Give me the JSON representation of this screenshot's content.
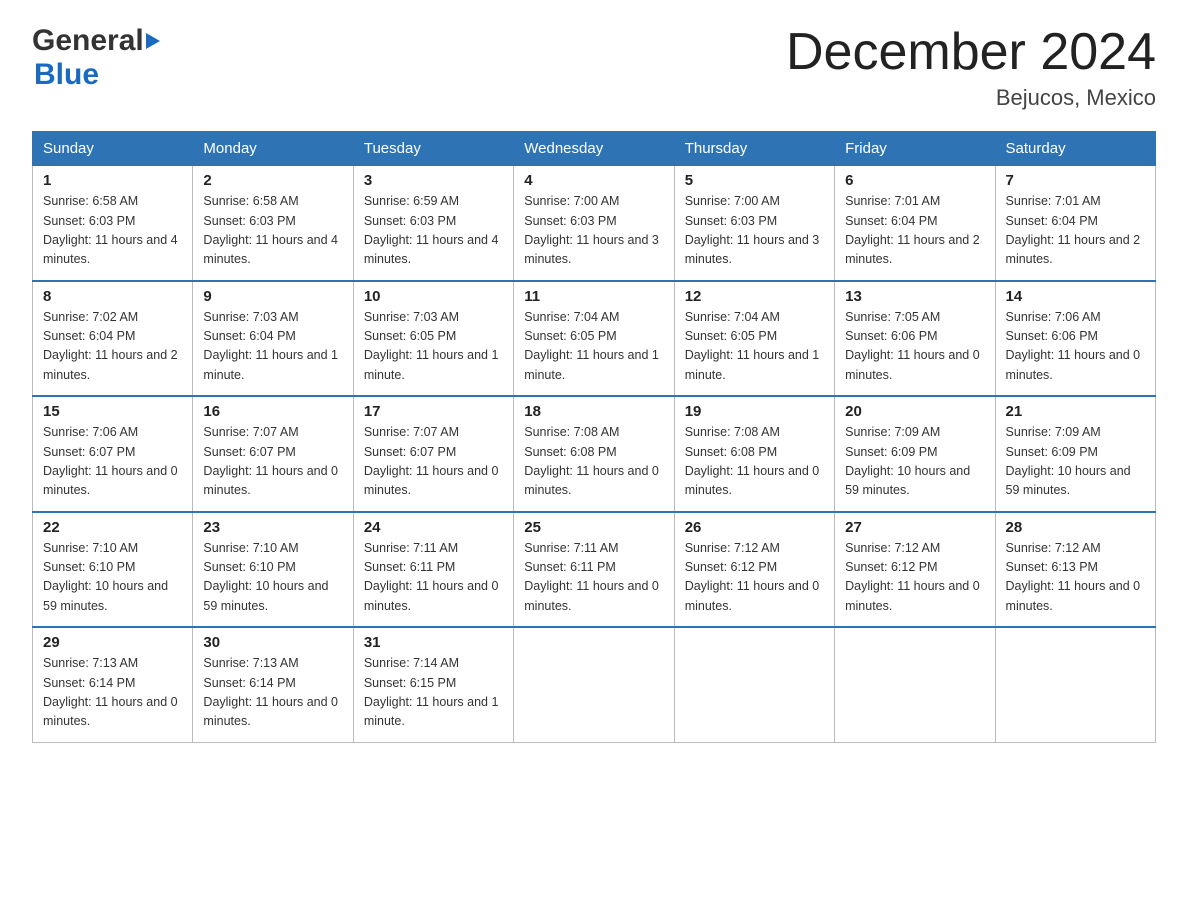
{
  "logo": {
    "general": "General",
    "blue": "Blue",
    "arrow": "▶"
  },
  "header": {
    "title": "December 2024",
    "subtitle": "Bejucos, Mexico"
  },
  "weekdays": [
    "Sunday",
    "Monday",
    "Tuesday",
    "Wednesday",
    "Thursday",
    "Friday",
    "Saturday"
  ],
  "weeks": [
    [
      {
        "day": "1",
        "sunrise": "6:58 AM",
        "sunset": "6:03 PM",
        "daylight": "11 hours and 4 minutes."
      },
      {
        "day": "2",
        "sunrise": "6:58 AM",
        "sunset": "6:03 PM",
        "daylight": "11 hours and 4 minutes."
      },
      {
        "day": "3",
        "sunrise": "6:59 AM",
        "sunset": "6:03 PM",
        "daylight": "11 hours and 4 minutes."
      },
      {
        "day": "4",
        "sunrise": "7:00 AM",
        "sunset": "6:03 PM",
        "daylight": "11 hours and 3 minutes."
      },
      {
        "day": "5",
        "sunrise": "7:00 AM",
        "sunset": "6:03 PM",
        "daylight": "11 hours and 3 minutes."
      },
      {
        "day": "6",
        "sunrise": "7:01 AM",
        "sunset": "6:04 PM",
        "daylight": "11 hours and 2 minutes."
      },
      {
        "day": "7",
        "sunrise": "7:01 AM",
        "sunset": "6:04 PM",
        "daylight": "11 hours and 2 minutes."
      }
    ],
    [
      {
        "day": "8",
        "sunrise": "7:02 AM",
        "sunset": "6:04 PM",
        "daylight": "11 hours and 2 minutes."
      },
      {
        "day": "9",
        "sunrise": "7:03 AM",
        "sunset": "6:04 PM",
        "daylight": "11 hours and 1 minute."
      },
      {
        "day": "10",
        "sunrise": "7:03 AM",
        "sunset": "6:05 PM",
        "daylight": "11 hours and 1 minute."
      },
      {
        "day": "11",
        "sunrise": "7:04 AM",
        "sunset": "6:05 PM",
        "daylight": "11 hours and 1 minute."
      },
      {
        "day": "12",
        "sunrise": "7:04 AM",
        "sunset": "6:05 PM",
        "daylight": "11 hours and 1 minute."
      },
      {
        "day": "13",
        "sunrise": "7:05 AM",
        "sunset": "6:06 PM",
        "daylight": "11 hours and 0 minutes."
      },
      {
        "day": "14",
        "sunrise": "7:06 AM",
        "sunset": "6:06 PM",
        "daylight": "11 hours and 0 minutes."
      }
    ],
    [
      {
        "day": "15",
        "sunrise": "7:06 AM",
        "sunset": "6:07 PM",
        "daylight": "11 hours and 0 minutes."
      },
      {
        "day": "16",
        "sunrise": "7:07 AM",
        "sunset": "6:07 PM",
        "daylight": "11 hours and 0 minutes."
      },
      {
        "day": "17",
        "sunrise": "7:07 AM",
        "sunset": "6:07 PM",
        "daylight": "11 hours and 0 minutes."
      },
      {
        "day": "18",
        "sunrise": "7:08 AM",
        "sunset": "6:08 PM",
        "daylight": "11 hours and 0 minutes."
      },
      {
        "day": "19",
        "sunrise": "7:08 AM",
        "sunset": "6:08 PM",
        "daylight": "11 hours and 0 minutes."
      },
      {
        "day": "20",
        "sunrise": "7:09 AM",
        "sunset": "6:09 PM",
        "daylight": "10 hours and 59 minutes."
      },
      {
        "day": "21",
        "sunrise": "7:09 AM",
        "sunset": "6:09 PM",
        "daylight": "10 hours and 59 minutes."
      }
    ],
    [
      {
        "day": "22",
        "sunrise": "7:10 AM",
        "sunset": "6:10 PM",
        "daylight": "10 hours and 59 minutes."
      },
      {
        "day": "23",
        "sunrise": "7:10 AM",
        "sunset": "6:10 PM",
        "daylight": "10 hours and 59 minutes."
      },
      {
        "day": "24",
        "sunrise": "7:11 AM",
        "sunset": "6:11 PM",
        "daylight": "11 hours and 0 minutes."
      },
      {
        "day": "25",
        "sunrise": "7:11 AM",
        "sunset": "6:11 PM",
        "daylight": "11 hours and 0 minutes."
      },
      {
        "day": "26",
        "sunrise": "7:12 AM",
        "sunset": "6:12 PM",
        "daylight": "11 hours and 0 minutes."
      },
      {
        "day": "27",
        "sunrise": "7:12 AM",
        "sunset": "6:12 PM",
        "daylight": "11 hours and 0 minutes."
      },
      {
        "day": "28",
        "sunrise": "7:12 AM",
        "sunset": "6:13 PM",
        "daylight": "11 hours and 0 minutes."
      }
    ],
    [
      {
        "day": "29",
        "sunrise": "7:13 AM",
        "sunset": "6:14 PM",
        "daylight": "11 hours and 0 minutes."
      },
      {
        "day": "30",
        "sunrise": "7:13 AM",
        "sunset": "6:14 PM",
        "daylight": "11 hours and 0 minutes."
      },
      {
        "day": "31",
        "sunrise": "7:14 AM",
        "sunset": "6:15 PM",
        "daylight": "11 hours and 1 minute."
      },
      null,
      null,
      null,
      null
    ]
  ],
  "labels": {
    "sunrise": "Sunrise:",
    "sunset": "Sunset:",
    "daylight": "Daylight:"
  }
}
